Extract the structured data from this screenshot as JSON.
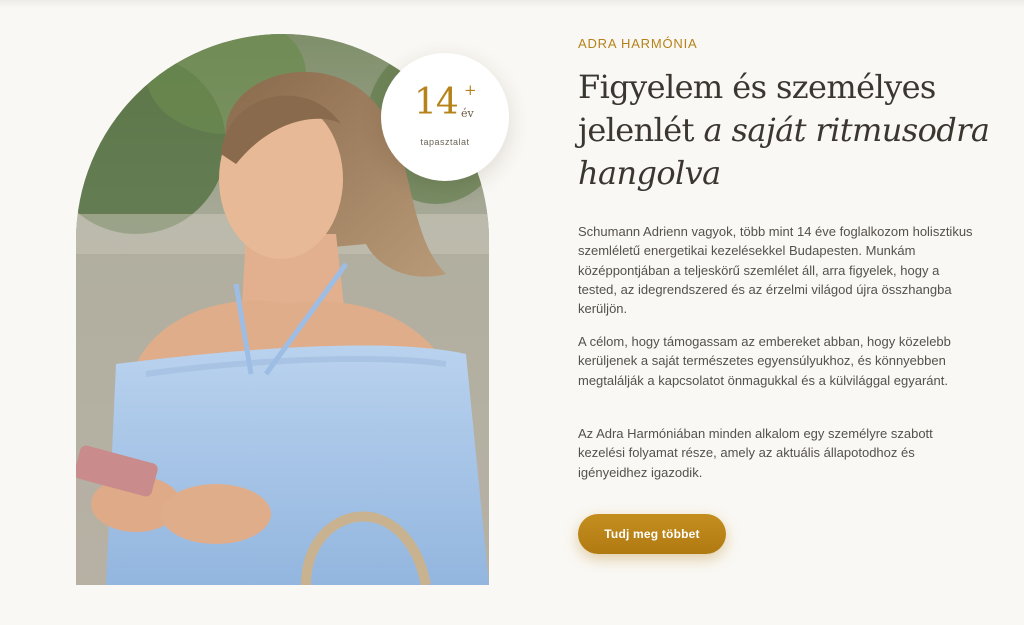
{
  "section": {
    "eyebrow": "ADRA HARMÓNIA",
    "heading_plain": "Figyelem és személyes jelenlét",
    "heading_italic": "a saját ritmusodra hangolva",
    "paragraphs": [
      "Schumann Adrienn vagyok, több mint 14 éve foglalkozom holisztikus szemléletű energetikai kezelésekkel Budapesten. Munkám középpontjában a teljeskörű szemlélet áll, arra figyelek, hogy a tested, az idegrendszered és az érzelmi világod újra összhangba kerüljön.",
      "A célom, hogy támogassam az embereket abban, hogy közelebb kerüljenek a saját természetes egyensúlyukhoz, és könnyebben megtalálják a kapcsolatot önmagukkal és a külvilággal egyaránt.",
      "Az Adra Harmóniában minden alkalom egy személyre szabott kezelési folyamat része, amely az aktuális állapotodhoz és igényeidhez igazodik."
    ],
    "cta_label": "Tudj meg többet"
  },
  "badge": {
    "number": "14",
    "plus": "+",
    "unit": "év",
    "caption": "tapasztalat"
  },
  "colors": {
    "accent": "#b5831a",
    "background": "#faf8f4",
    "heading": "#3b3630",
    "body_text": "#55514b",
    "button": "#bb8519"
  }
}
